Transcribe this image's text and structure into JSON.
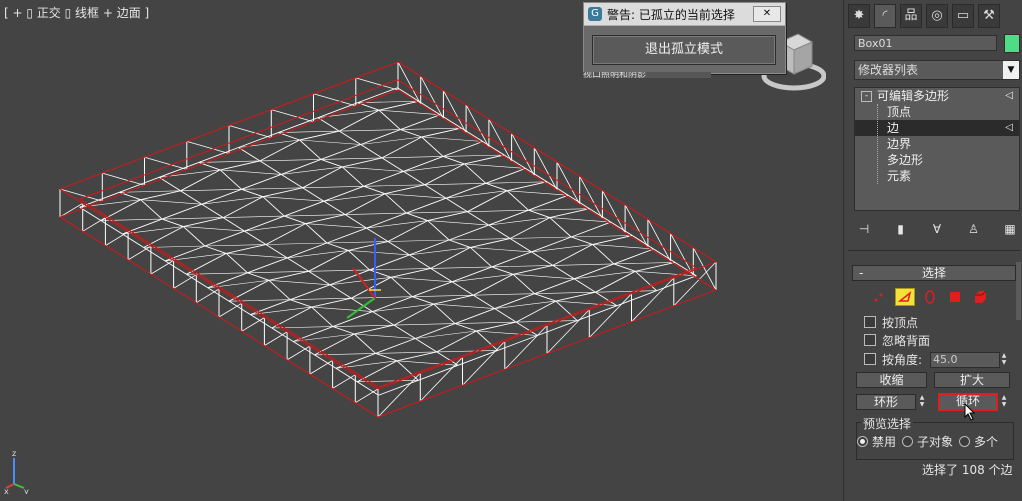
{
  "viewport": {
    "label": "[ + ▯ 正交 ▯ 线框 + 边面 ]"
  },
  "isolate_dialog": {
    "title": "警告: 已孤立的当前选择",
    "close_label": "✕",
    "exit_button": "退出孤立模式",
    "under_text": "视口照明和阴影"
  },
  "command_panel": {
    "tabs": [
      "create-icon",
      "modify-icon",
      "hierarchy-icon",
      "motion-icon",
      "display-icon",
      "utilities-icon"
    ],
    "object_name": "Box01",
    "object_color": "#4fdc86",
    "modifier_list": "修改器列表",
    "stack": {
      "root": "可编辑多边形",
      "subobjects": [
        "顶点",
        "边",
        "边界",
        "多边形",
        "元素"
      ],
      "selected": "边"
    }
  },
  "selection_rollout": {
    "title": "选择",
    "collapse": "-",
    "checkbox_by_vertex": "按顶点",
    "checkbox_ignore_backfacing": "忽略背面",
    "checkbox_by_angle": "按角度:",
    "angle_value": "45.0",
    "shrink": "收缩",
    "grow": "扩大",
    "ring": "环形",
    "loop": "循环",
    "preview_group": "预览选择",
    "preview_options": [
      "禁用",
      "子对象",
      "多个"
    ],
    "preview_selected": "禁用",
    "status": "选择了 108 个边"
  },
  "colors": {
    "viewport_bg": "#444444",
    "panel_bg": "#444444",
    "wire": "#ffffff",
    "selected_edges": "#cc1a1a",
    "active_subobject": "#f4e23a"
  }
}
